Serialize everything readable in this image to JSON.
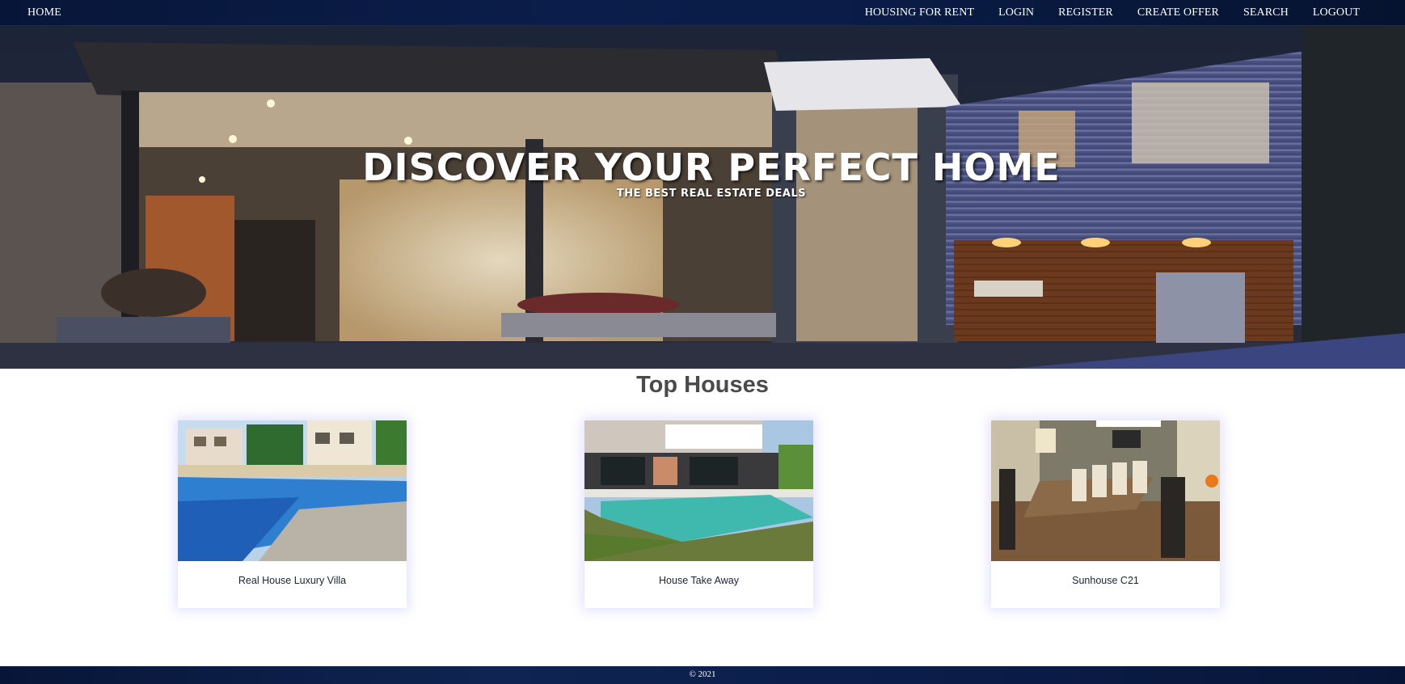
{
  "nav": {
    "home": "HOME",
    "links": [
      "HOUSING FOR RENT",
      "LOGIN",
      "REGISTER",
      "CREATE OFFER",
      "SEARCH",
      "LOGOUT"
    ]
  },
  "hero": {
    "title": "DISCOVER YOUR PERFECT HOME",
    "subtitle": "THE BEST REAL ESTATE DEALS"
  },
  "section": {
    "title": "Top Houses"
  },
  "listings": [
    {
      "name": "Real House Luxury Villa",
      "image": "villa-pool-photo"
    },
    {
      "name": "House Take Away",
      "image": "modern-house-pool-photo"
    },
    {
      "name": "Sunhouse C21",
      "image": "dining-room-photo"
    }
  ],
  "footer": {
    "copyright": "© 2021"
  },
  "colors": {
    "navbar": "#0b1d4a",
    "footer": "#0b1d4a",
    "title": "#4a4a4a",
    "card_glow": "#aaa0ff"
  }
}
